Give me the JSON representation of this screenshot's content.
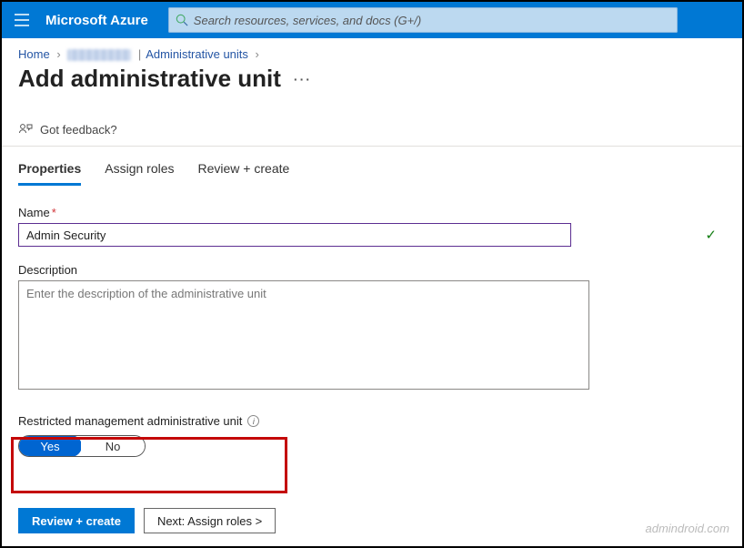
{
  "header": {
    "brand": "Microsoft Azure",
    "search_placeholder": "Search resources, services, and docs (G+/)"
  },
  "breadcrumb": {
    "home": "Home",
    "section": "Administrative units"
  },
  "page": {
    "title": "Add administrative unit"
  },
  "feedback": {
    "label": "Got feedback?"
  },
  "tabs": {
    "properties": "Properties",
    "assign_roles": "Assign roles",
    "review": "Review + create"
  },
  "form": {
    "name_label": "Name",
    "name_value": "Admin Security",
    "desc_label": "Description",
    "desc_placeholder": "Enter the description of the administrative unit",
    "restricted_label": "Restricted management administrative unit",
    "toggle_yes": "Yes",
    "toggle_no": "No"
  },
  "buttons": {
    "review_create": "Review + create",
    "next": "Next: Assign roles >"
  },
  "watermark": "admindroid.com"
}
